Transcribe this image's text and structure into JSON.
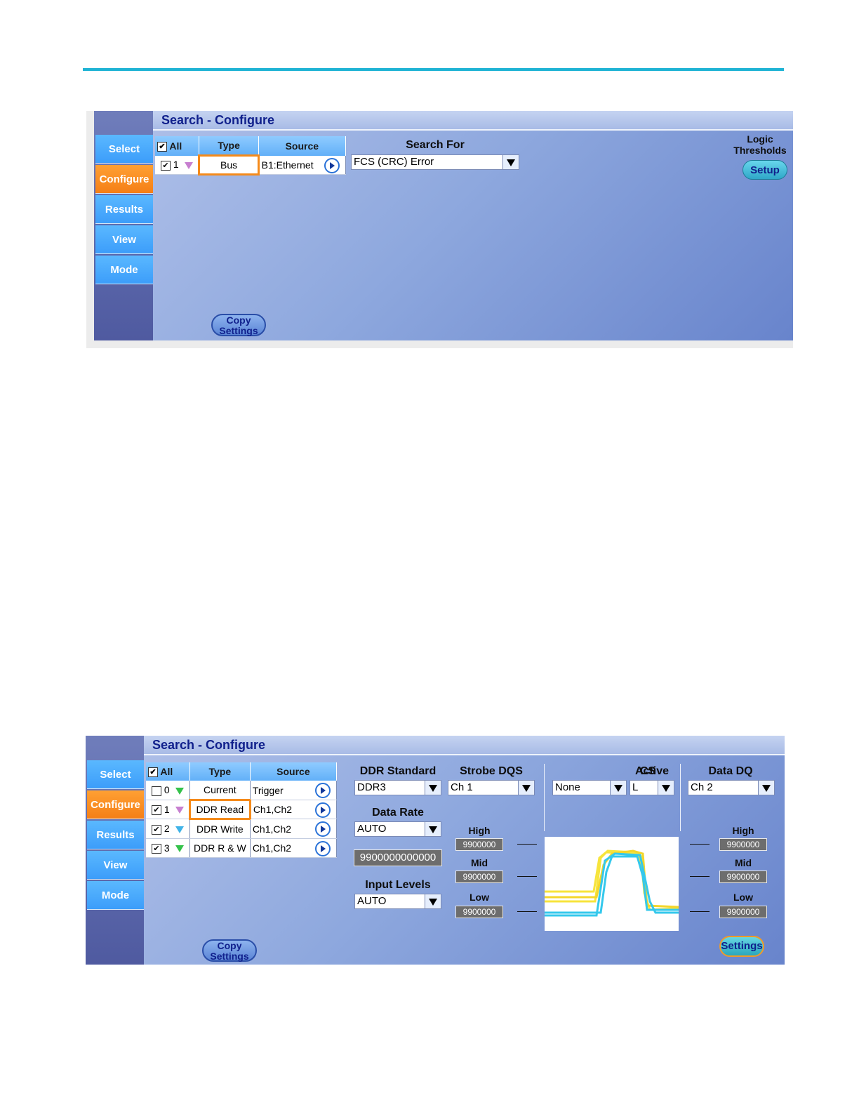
{
  "panel1": {
    "title": "Search - Configure",
    "nav": [
      "Select",
      "Configure",
      "Results",
      "View",
      "Mode"
    ],
    "active_nav": "Configure",
    "table": {
      "headers": {
        "all": "All",
        "type": "Type",
        "source": "Source"
      },
      "all_checked": true,
      "rows": [
        {
          "checked": true,
          "index": "1",
          "marker_color": "#c77fd0",
          "type": "Bus",
          "source": "B1:Ethernet"
        }
      ]
    },
    "search_for_label": "Search For",
    "search_for_value": "FCS (CRC) Error",
    "logic_thresholds_label_1": "Logic",
    "logic_thresholds_label_2": "Thresholds",
    "setup_button": "Setup",
    "copy_settings_1": "Copy",
    "copy_settings_2": "Settings"
  },
  "panel2": {
    "title": "Search - Configure",
    "nav": [
      "Select",
      "Configure",
      "Results",
      "View",
      "Mode"
    ],
    "active_nav": "Configure",
    "table": {
      "headers": {
        "all": "All",
        "type": "Type",
        "source": "Source"
      },
      "all_checked": true,
      "rows": [
        {
          "checked": false,
          "index": "0",
          "marker_color": "#34c24a",
          "type": "Current",
          "source": "Trigger"
        },
        {
          "checked": true,
          "index": "1",
          "marker_color": "#c77fd0",
          "type": "DDR Read",
          "source": "Ch1,Ch2"
        },
        {
          "checked": true,
          "index": "2",
          "marker_color": "#3fb3e8",
          "type": "DDR Write",
          "source": "Ch1,Ch2"
        },
        {
          "checked": true,
          "index": "3",
          "marker_color": "#34c24a",
          "type": "DDR R & W",
          "source": "Ch1,Ch2"
        }
      ]
    },
    "ddr_standard_label": "DDR Standard",
    "ddr_standard_value": "DDR3",
    "strobe_label": "Strobe DQS",
    "strobe_value": "Ch 1",
    "cs_label": "CS",
    "cs_value": "None",
    "active_label": "Active",
    "active_value": "L",
    "data_dq_label": "Data DQ",
    "data_dq_value": "Ch 2",
    "data_rate_label": "Data Rate",
    "data_rate_value": "AUTO",
    "data_rate_number": "9900000000000",
    "input_levels_label": "Input Levels",
    "input_levels_value": "AUTO",
    "left_levels": {
      "high_label": "High",
      "high": "9900000",
      "mid_label": "Mid",
      "mid": "9900000",
      "low_label": "Low",
      "low": "9900000"
    },
    "right_levels": {
      "high_label": "High",
      "high": "9900000",
      "mid_label": "Mid",
      "mid": "9900000",
      "low_label": "Low",
      "low": "9900000"
    },
    "copy_settings_1": "Copy",
    "copy_settings_2": "Settings",
    "settings_button": "Settings"
  },
  "colors": {
    "accent_rule": "#1fb3d4",
    "nav_blue": "#3c9dfa",
    "nav_active": "#f57f16",
    "title_text": "#10208c",
    "wave_yellow": "#f7e43c",
    "wave_cyan": "#34c8ec"
  }
}
